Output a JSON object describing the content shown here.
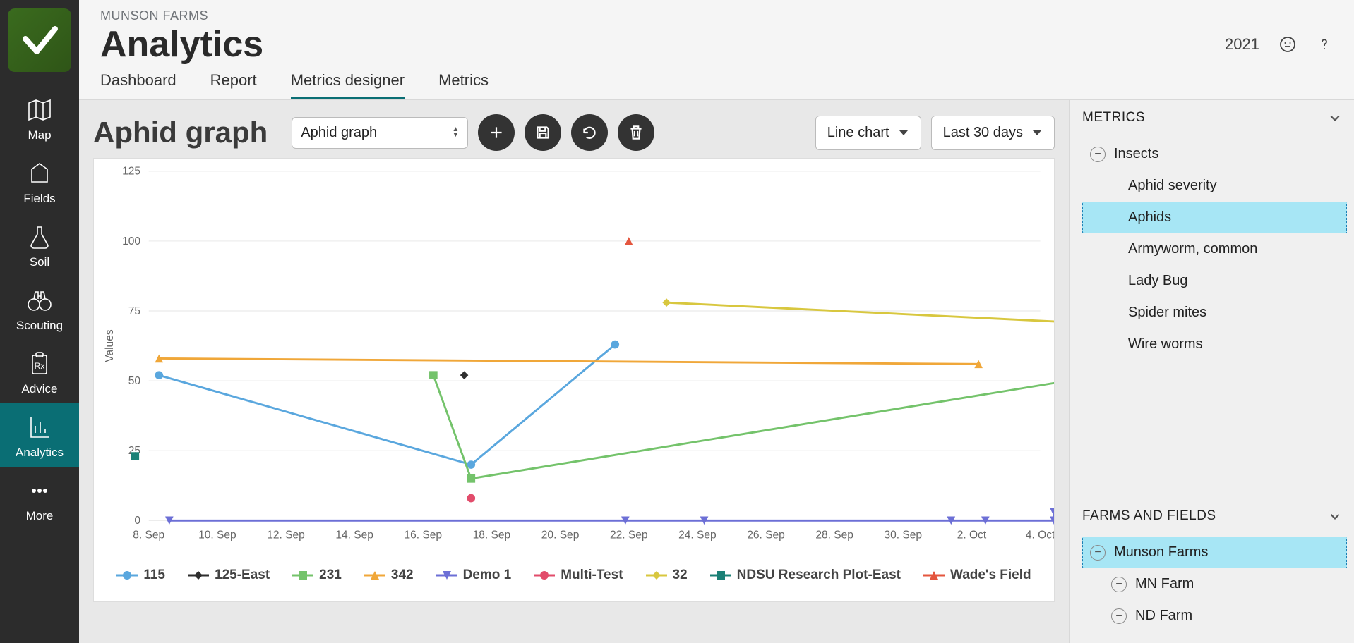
{
  "header": {
    "breadcrumb": "MUNSON FARMS",
    "title": "Analytics",
    "year": "2021"
  },
  "tabs": [
    {
      "label": "Dashboard",
      "active": false
    },
    {
      "label": "Report",
      "active": false
    },
    {
      "label": "Metrics designer",
      "active": true
    },
    {
      "label": "Metrics",
      "active": false
    }
  ],
  "sidebar": [
    {
      "label": "Map",
      "icon": "map-icon"
    },
    {
      "label": "Fields",
      "icon": "field-icon"
    },
    {
      "label": "Soil",
      "icon": "flask-icon"
    },
    {
      "label": "Scouting",
      "icon": "binoculars-icon"
    },
    {
      "label": "Advice",
      "icon": "clipboard-icon"
    },
    {
      "label": "Analytics",
      "icon": "chart-icon",
      "active": true
    },
    {
      "label": "More",
      "icon": "more-icon"
    }
  ],
  "toolbar": {
    "graph_title": "Aphid graph",
    "select_value": "Aphid graph",
    "chart_type": "Line chart",
    "time_range": "Last 30 days"
  },
  "right": {
    "metrics_title": "METRICS",
    "farms_title": "FARMS AND FIELDS",
    "metrics_tree": {
      "group": "Insects",
      "items": [
        "Aphid severity",
        "Aphids",
        "Armyworm, common",
        "Lady Bug",
        "Spider mites",
        "Wire worms"
      ],
      "selected": "Aphids"
    },
    "farms_tree": {
      "root": "Munson Farms",
      "children": [
        "MN Farm",
        "ND Farm"
      ]
    }
  },
  "chart_data": {
    "type": "line",
    "ylabel": "Values",
    "ylim": [
      0,
      125
    ],
    "yticks": [
      0,
      25,
      50,
      75,
      100,
      125
    ],
    "categories": [
      "8. Sep",
      "10. Sep",
      "12. Sep",
      "14. Sep",
      "16. Sep",
      "18. Sep",
      "20. Sep",
      "22. Sep",
      "24. Sep",
      "26. Sep",
      "28. Sep",
      "30. Sep",
      "2. Oct",
      "4. Oct"
    ],
    "series": [
      {
        "name": "115",
        "color": "#5aa7de",
        "marker": "circle",
        "points": [
          {
            "x": 0.15,
            "y": 52
          },
          {
            "x": 4.7,
            "y": 20
          },
          {
            "x": 6.8,
            "y": 63
          }
        ]
      },
      {
        "name": "125-East",
        "color": "#2e2e2e",
        "marker": "diamond",
        "points": [
          {
            "x": 4.6,
            "y": 52
          }
        ]
      },
      {
        "name": "231",
        "color": "#74c36b",
        "marker": "square",
        "points": [
          {
            "x": 4.15,
            "y": 52
          },
          {
            "x": 4.7,
            "y": 15
          },
          {
            "x": 13.4,
            "y": 50
          }
        ]
      },
      {
        "name": "342",
        "color": "#f0a739",
        "marker": "triangle-up",
        "points": [
          {
            "x": 0.15,
            "y": 58
          },
          {
            "x": 12.1,
            "y": 56
          }
        ]
      },
      {
        "name": "Demo 1",
        "color": "#6c6fd6",
        "marker": "triangle-down",
        "points": [
          {
            "x": 0.3,
            "y": 0
          },
          {
            "x": 6.95,
            "y": 0
          },
          {
            "x": 8.1,
            "y": 0
          },
          {
            "x": 11.7,
            "y": 0
          },
          {
            "x": 12.2,
            "y": 0
          },
          {
            "x": 13.2,
            "y": 0
          },
          {
            "x": 13.2,
            "y": 3
          }
        ]
      },
      {
        "name": "Multi-Test",
        "color": "#e24c6b",
        "marker": "circle",
        "points": [
          {
            "x": 4.7,
            "y": 8
          }
        ]
      },
      {
        "name": "32",
        "color": "#d8c73f",
        "marker": "diamond",
        "points": [
          {
            "x": 7.55,
            "y": 78
          },
          {
            "x": 13.4,
            "y": 71
          }
        ]
      },
      {
        "name": "NDSU Research Plot-East",
        "color": "#1b8076",
        "marker": "square",
        "points": [
          {
            "x": -0.2,
            "y": 23
          }
        ]
      },
      {
        "name": "Wade's Field",
        "color": "#e4563e",
        "marker": "triangle-up",
        "points": [
          {
            "x": 7.0,
            "y": 100
          }
        ]
      }
    ]
  }
}
